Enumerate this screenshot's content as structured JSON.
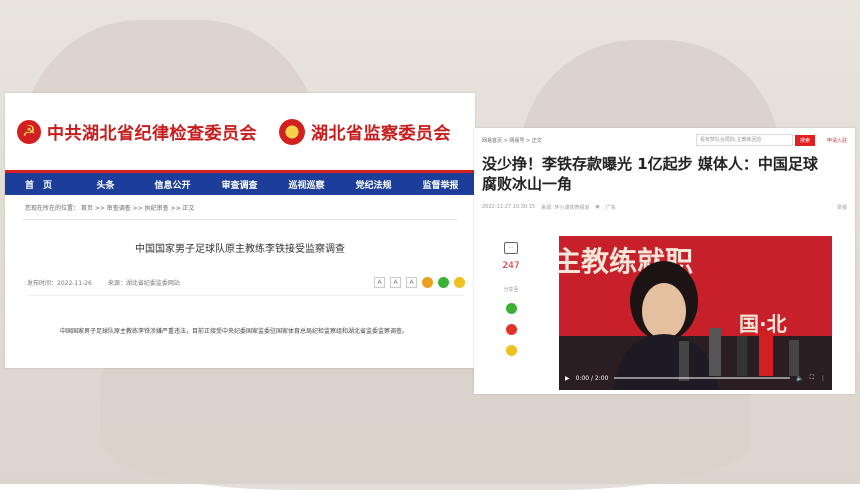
{
  "panel1": {
    "org_left": "中共湖北省纪律检查委员会",
    "org_right": "湖北省监察委员会",
    "nav": [
      "首　页",
      "头条",
      "信息公开",
      "审查调查",
      "巡视巡察",
      "党纪法规",
      "监督举报"
    ],
    "breadcrumb": "您现在所在的位置： 首页 >> 审查调查 >> 执纪审查 >> 正文",
    "title": "中国国家男子足球队原主教练李铁接受监察调查",
    "publish": "发布时间：2022-11-26",
    "source": "来源：湖北省纪委监委网站",
    "font_buttons": [
      "A",
      "A",
      "A"
    ],
    "body": "中国国家男子足球队原主教练李铁涉嫌严重违法，目前正接受中央纪委国家监委驻国家体育总局纪检监察组和湖北省监委监察调查。"
  },
  "panel2": {
    "breadcrumb": "网易首页 > 网易号 > 正文",
    "search_placeholder": "看有梦队台局际,主教练回应",
    "search_button": "搜索",
    "external_link": "申请入驻",
    "headline": "没少挣！李铁存款曝光 1亿起步 媒体人：中国足球腐败冰山一角",
    "meta": {
      "time": "2022-11-27 10:30:15",
      "source": "来源: 环小漫体育频道",
      "location": "广东",
      "report": "举报"
    },
    "comment_count": "247",
    "share_label": "分享至",
    "video": {
      "time": "0:00 / 2:00",
      "banner_text": "主教练就职",
      "backdrop_text": "国·北"
    }
  },
  "colors": {
    "brand_red": "#c81c1c",
    "nav_blue": "#1c3e9a",
    "accent_red": "#e02020"
  }
}
